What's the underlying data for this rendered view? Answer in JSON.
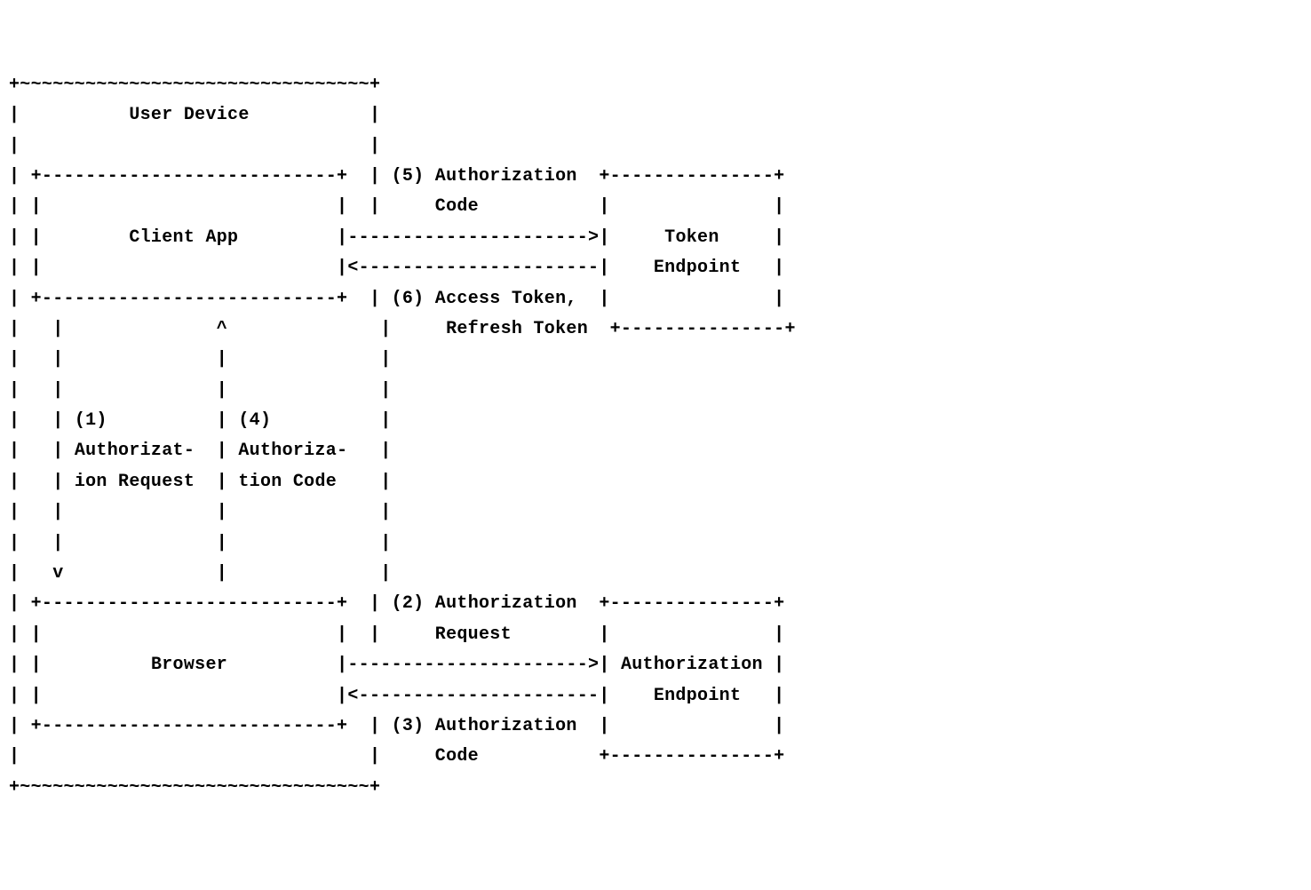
{
  "diagram": {
    "title": "User Device",
    "boxes": {
      "client_app": "Client App",
      "browser": "Browser",
      "token_endpoint_line1": "Token",
      "token_endpoint_line2": "Endpoint",
      "auth_endpoint_line1": "Authorization",
      "auth_endpoint_line2": "Endpoint"
    },
    "steps": {
      "s1": "(1)",
      "s1_label1": "Authorizat-",
      "s1_label2": "ion Request",
      "s2": "(2) Authorization",
      "s2_label": "Request",
      "s3": "(3) Authorization",
      "s3_label": "Code",
      "s4": "(4)",
      "s4_label1": "Authoriza-",
      "s4_label2": "tion Code",
      "s5": "(5) Authorization",
      "s5_label": "Code",
      "s6": "(6) Access Token,",
      "s6_label": "Refresh Token"
    }
  }
}
